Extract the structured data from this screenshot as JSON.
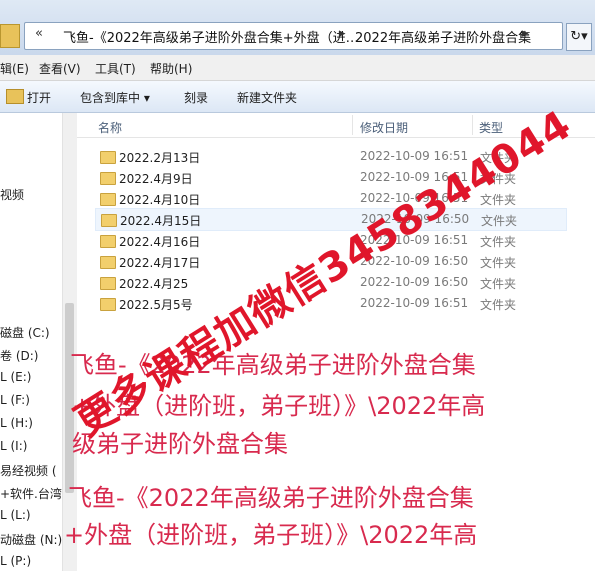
{
  "address": {
    "chevrons": "«",
    "seg1": "飞鱼-《2022年高级弟子进阶外盘合集+外盘（进…",
    "arrow1": "▸",
    "seg2": "2022年高级弟子进阶外盘合集",
    "arrow2": "▸",
    "refresh": "↻▾"
  },
  "menu": {
    "edit": "辑(E)",
    "view": "查看(V)",
    "tools": "工具(T)",
    "help": "帮助(H)"
  },
  "toolbar": {
    "open": "打开",
    "include": "包含到库中 ▾",
    "burn": "刻录",
    "newfolder": "新建文件夹"
  },
  "nav": [
    {
      "label": "视频"
    },
    {
      "label": "磁盘 (C:)"
    },
    {
      "label": "卷 (D:)"
    },
    {
      "label": "L (E:)"
    },
    {
      "label": "L (F:)"
    },
    {
      "label": "L (H:)"
    },
    {
      "label": "L (I:)"
    },
    {
      "label": "易经视频 ("
    },
    {
      "label": "+软件.台湾"
    },
    {
      "label": "L (L:)"
    },
    {
      "label": "动磁盘 (N:)"
    },
    {
      "label": "L (P:)"
    }
  ],
  "columns": {
    "name": "名称",
    "date": "修改日期",
    "type": "类型"
  },
  "files": [
    {
      "name": "2022.2月13日",
      "date": "2022-10-09 16:51",
      "type": "文件夹"
    },
    {
      "name": "2022.4月9日",
      "date": "2022-10-09 16:51",
      "type": "文件夹"
    },
    {
      "name": "2022.4月10日",
      "date": "2022-10-09 16:51",
      "type": "文件夹"
    },
    {
      "name": "2022.4月15日",
      "date": "2022-10-09 16:50",
      "type": "文件夹"
    },
    {
      "name": "2022.4月16日",
      "date": "2022-10-09 16:51",
      "type": "文件夹"
    },
    {
      "name": "2022.4月17日",
      "date": "2022-10-09 16:50",
      "type": "文件夹"
    },
    {
      "name": "2022.4月25",
      "date": "2022-10-09 16:50",
      "type": "文件夹"
    },
    {
      "name": "2022.5月5号",
      "date": "2022-10-09 16:51",
      "type": "文件夹"
    }
  ],
  "overlay": {
    "watermark": "更多课程加微信3458344044",
    "line1": "飞鱼-《2022年高级弟子进阶外盘合集",
    "line2": "+外盘（进阶班，弟子班）》\\2022年高",
    "line3": "级弟子进阶外盘合集",
    "line4": "飞鱼-《2022年高级弟子进阶外盘合集",
    "line5": "+外盘（进阶班，弟子班）》\\2022年高"
  }
}
